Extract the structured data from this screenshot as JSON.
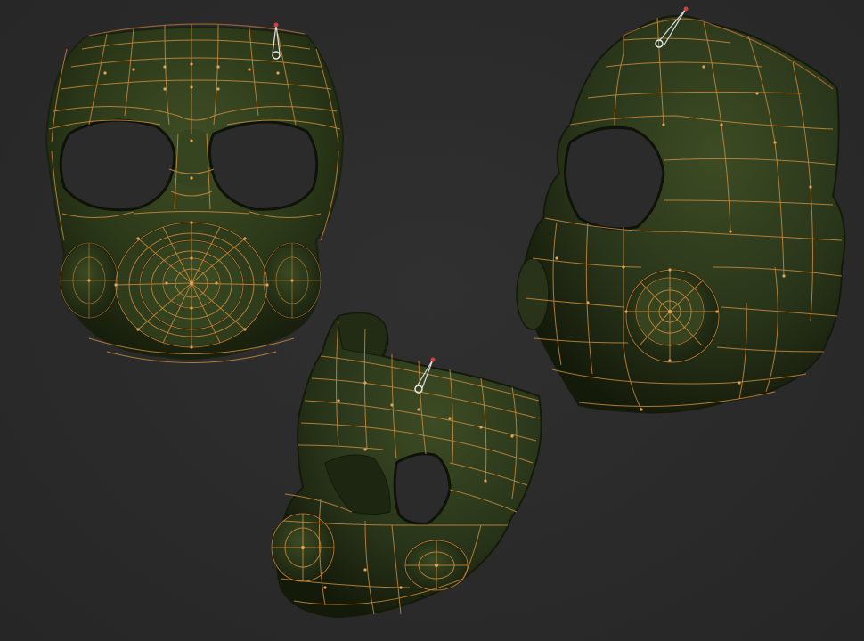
{
  "scene": {
    "background_color": "#2b2b2b",
    "mask_color": "#2e3a1c",
    "wire_color": "#c98a3a",
    "vertex_color": "#e2a45a",
    "views": [
      "mask-front-view",
      "mask-side-view",
      "mask-three-quarter-view"
    ]
  }
}
